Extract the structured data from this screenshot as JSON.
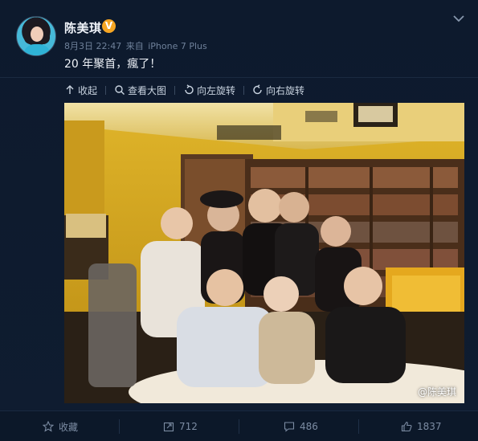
{
  "post": {
    "author_name": "陈美琪",
    "verified_badge": "V",
    "date": "8月3日 22:47",
    "source_prefix": "来自",
    "source": "iPhone 7 Plus",
    "text": "20 年聚首，瘋了！"
  },
  "toolbar": {
    "collapse": "收起",
    "view_large": "查看大图",
    "rotate_left": "向左旋转",
    "rotate_right": "向右旋转"
  },
  "photo": {
    "watermark": "@陈美琪"
  },
  "footer": {
    "favorite_label": "收藏",
    "repost_count": "712",
    "comment_count": "486",
    "like_count": "1837"
  },
  "colors": {
    "background": "#0e1a2c",
    "verified": "#f6a623",
    "muted_text": "#6f819a"
  }
}
